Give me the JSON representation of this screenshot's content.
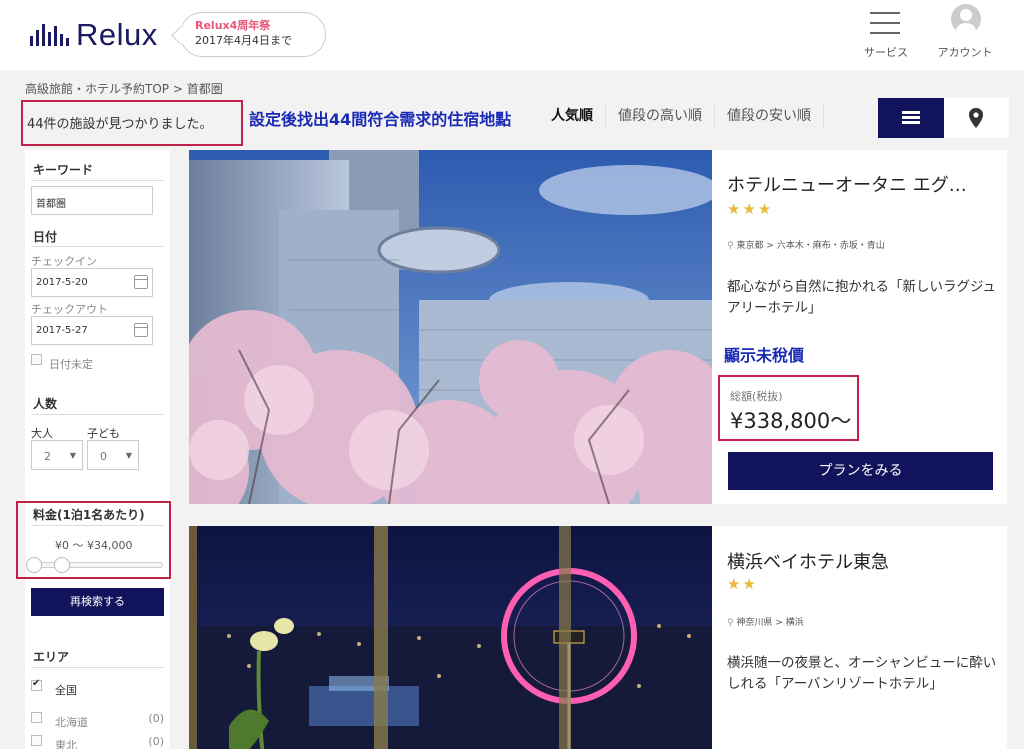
{
  "header": {
    "logo_text": "Relux",
    "promo_title": "Relux4周年祭",
    "promo_date": "2017年4月4日まで",
    "services_label": "サービス",
    "account_label": "アカウント",
    "menu_icon": "hamburger-icon",
    "account_icon": "user-avatar-icon"
  },
  "breadcrumb": "高級旅館・ホテル予約TOP > 首都圏",
  "results": {
    "count_text": "44件の施設が見つかりました。",
    "annotation": "設定後找出44間符合需求的住宿地點"
  },
  "sort": {
    "items": [
      "人気順",
      "値段の高い順",
      "値段の安い順"
    ],
    "active": "人気順"
  },
  "view_toggle": {
    "list_icon": "list-view-icon",
    "map_icon": "map-pin-icon"
  },
  "sidebar": {
    "keyword_heading": "キーワード",
    "keyword_value": "首都圏",
    "date_heading": "日付",
    "checkin_label": "チェックイン",
    "checkin_value": "2017-5-20",
    "checkout_label": "チェックアウト",
    "checkout_value": "2017-5-27",
    "date_undecided": "日付未定",
    "people_heading": "人数",
    "adults_label": "大人",
    "adults_value": "2",
    "children_label": "子ども",
    "children_value": "0",
    "price_heading": "料金(1泊1名あたり)",
    "price_range": "¥0 〜 ¥34,000",
    "search_button": "再検索する",
    "area_heading": "エリア",
    "areas": [
      {
        "name": "全国",
        "count": "",
        "checked": true
      },
      {
        "name": "北海道",
        "count": "(0)",
        "checked": false
      },
      {
        "name": "東北",
        "count": "(0)",
        "checked": false
      }
    ]
  },
  "hotels": [
    {
      "name": "ホテルニューオータニ エグ…",
      "stars": "★★★",
      "location": "東京都 > 六本木・麻布・赤坂・青山",
      "description": "都心ながら自然に抱かれる「新しいラグジュアリーホテル」",
      "tax_note": "顯示未稅價",
      "price_label": "総額(税抜)",
      "price": "¥338,800〜",
      "plan_button": "プランをみる"
    },
    {
      "name": "横浜ベイホテル東急",
      "stars": "★★",
      "location": "神奈川県 > 横浜",
      "description": "横浜随一の夜景と、オーシャンビューに酔いしれる「アーバンリゾートホテル」"
    }
  ]
}
